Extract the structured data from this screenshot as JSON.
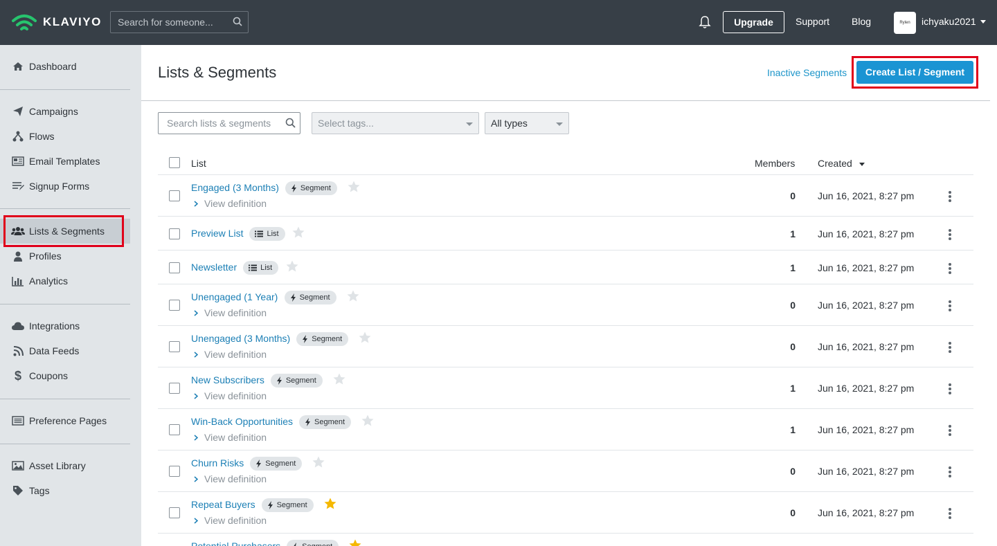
{
  "topbar": {
    "brand": "KLAVIYO",
    "search_placeholder": "Search for someone...",
    "upgrade_label": "Upgrade",
    "support_label": "Support",
    "blog_label": "Blog",
    "avatar_text": "Rylen",
    "username": "ichyaku2021"
  },
  "sidebar": {
    "dashboard": "Dashboard",
    "campaigns": "Campaigns",
    "flows": "Flows",
    "email_templates": "Email Templates",
    "signup_forms": "Signup Forms",
    "lists_segments": "Lists & Segments",
    "profiles": "Profiles",
    "analytics": "Analytics",
    "integrations": "Integrations",
    "data_feeds": "Data Feeds",
    "coupons": "Coupons",
    "preference_pages": "Preference Pages",
    "asset_library": "Asset Library",
    "tags": "Tags"
  },
  "main": {
    "title": "Lists & Segments",
    "inactive_link": "Inactive Segments",
    "create_button": "Create List / Segment",
    "search_placeholder": "Search lists & segments",
    "tags_placeholder": "Select tags...",
    "types_value": "All types",
    "columns": {
      "list": "List",
      "members": "Members",
      "created": "Created"
    },
    "view_definition": "View definition",
    "rows": [
      {
        "name": "Engaged (3 Months)",
        "type": "Segment",
        "starred": false,
        "members": "0",
        "created": "Jun 16, 2021, 8:27 pm"
      },
      {
        "name": "Preview List",
        "type": "List",
        "starred": false,
        "members": "1",
        "created": "Jun 16, 2021, 8:27 pm"
      },
      {
        "name": "Newsletter",
        "type": "List",
        "starred": false,
        "members": "1",
        "created": "Jun 16, 2021, 8:27 pm"
      },
      {
        "name": "Unengaged (1 Year)",
        "type": "Segment",
        "starred": false,
        "members": "0",
        "created": "Jun 16, 2021, 8:27 pm"
      },
      {
        "name": "Unengaged (3 Months)",
        "type": "Segment",
        "starred": false,
        "members": "0",
        "created": "Jun 16, 2021, 8:27 pm"
      },
      {
        "name": "New Subscribers",
        "type": "Segment",
        "starred": false,
        "members": "1",
        "created": "Jun 16, 2021, 8:27 pm"
      },
      {
        "name": "Win-Back Opportunities",
        "type": "Segment",
        "starred": false,
        "members": "1",
        "created": "Jun 16, 2021, 8:27 pm"
      },
      {
        "name": "Churn Risks",
        "type": "Segment",
        "starred": false,
        "members": "0",
        "created": "Jun 16, 2021, 8:27 pm"
      },
      {
        "name": "Repeat Buyers",
        "type": "Segment",
        "starred": true,
        "members": "0",
        "created": "Jun 16, 2021, 8:27 pm"
      },
      {
        "name": "Potential Purchasers",
        "type": "Segment",
        "starred": true,
        "members": "",
        "created": ""
      }
    ]
  },
  "colors": {
    "topbar": "#373f47",
    "sidebar": "#e1e5e8",
    "link": "#1b7fb5",
    "primary_button": "#1b94d3",
    "highlight": "#e0001a",
    "star_active": "#f5b800",
    "star_inactive": "#dfe3e6"
  }
}
